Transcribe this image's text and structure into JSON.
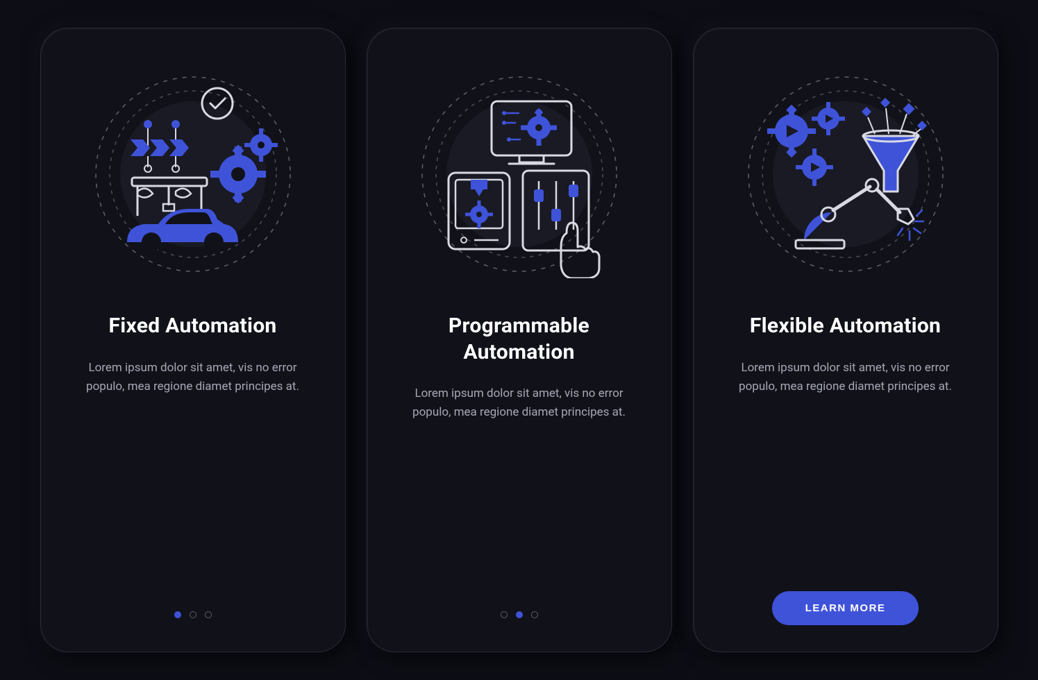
{
  "colors": {
    "background": "#0d0e15",
    "card": "#111219",
    "accent": "#3f53d9",
    "text": "#ffffff",
    "muted": "#a5a7b5",
    "stroke": "#d8d9e3"
  },
  "screens": [
    {
      "icon": "fixed-automation-icon",
      "title": "Fixed Automation",
      "description": "Lorem ipsum dolor sit amet, vis no error populo, mea regione diamet principes at.",
      "pagination_active": 0,
      "cta": null
    },
    {
      "icon": "programmable-automation-icon",
      "title": "Programmable Automation",
      "description": "Lorem ipsum dolor sit amet, vis no error populo, mea regione diamet principes at.",
      "pagination_active": 1,
      "cta": null
    },
    {
      "icon": "flexible-automation-icon",
      "title": "Flexible Automation",
      "description": "Lorem ipsum dolor sit amet, vis no error populo, mea regione diamet principes at.",
      "pagination_active": null,
      "cta": "LEARN MORE"
    }
  ]
}
